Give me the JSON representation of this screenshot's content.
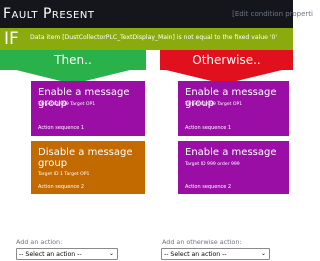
{
  "header": {
    "title": "Fault Present",
    "edit_link": "[Edit condition properti"
  },
  "condition": {
    "keyword": "IF",
    "text": "Data item [DustCollectorPLC_TextDisplay_Main] is not equal to the fixed value '0'"
  },
  "columns": {
    "then_label": "Then..",
    "otherwise_label": "Otherwise.."
  },
  "then_actions": [
    {
      "title": "Enable a message group",
      "target": "Target ID 999 Target OP1",
      "sequence": "Action sequence 1",
      "color": "#9a0ea6"
    },
    {
      "title": "Disable a message group",
      "target": "Target ID 1 Target OP1",
      "sequence": "Action sequence 2",
      "color": "#c26a00"
    }
  ],
  "otherwise_actions": [
    {
      "title": "Enable a message group",
      "target": "Target ID 999 Target OP1",
      "sequence": "Action sequence 1",
      "color": "#9a0ea6"
    },
    {
      "title": "Enable a message",
      "target": "Target ID 999 order 999",
      "sequence": "Action sequence 2",
      "color": "#9a0ea6"
    }
  ],
  "add_action": {
    "label": "Add an action:",
    "selected": "-- Select an action --"
  },
  "add_otherwise_action": {
    "label": "Add an otherwise action:",
    "selected": "-- Select an action --"
  },
  "colors": {
    "header_bg": "#14161b",
    "condition_bg": "#8aab0e",
    "then": "#2bb14a",
    "otherwise": "#e0111c",
    "content_bg": "#1d2028"
  }
}
